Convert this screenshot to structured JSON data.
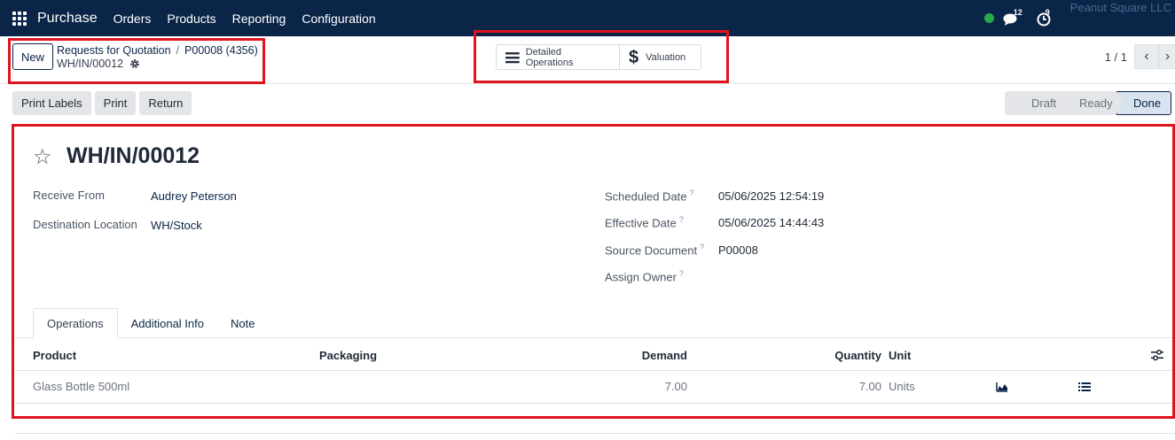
{
  "navbar": {
    "app_name": "Purchase",
    "menu": [
      "Orders",
      "Products",
      "Reporting",
      "Configuration"
    ],
    "messages_count": "12",
    "activities_count": "9",
    "company": "Peanut Square LLC"
  },
  "control_panel": {
    "new_label": "New",
    "breadcrumb": [
      "Requests for Quotation",
      "P00008 (4356)"
    ],
    "record_name": "WH/IN/00012",
    "smart_buttons": [
      "Detailed Operations",
      "Valuation"
    ],
    "pager": "1 / 1"
  },
  "actions": [
    "Print Labels",
    "Print",
    "Return"
  ],
  "stages": [
    "Draft",
    "Ready",
    "Done"
  ],
  "active_stage": "Done",
  "form": {
    "title": "WH/IN/00012",
    "left_fields": [
      {
        "label": "Receive From",
        "value": "Audrey Peterson"
      },
      {
        "label": "Destination Location",
        "value": "WH/Stock"
      }
    ],
    "right_fields": [
      {
        "label": "Scheduled Date",
        "value": "05/06/2025 12:54:19"
      },
      {
        "label": "Effective Date",
        "value": "05/06/2025 14:44:43"
      },
      {
        "label": "Source Document",
        "value": "P00008"
      },
      {
        "label": "Assign Owner",
        "value": ""
      }
    ],
    "help_mark": "?",
    "tabs": [
      "Operations",
      "Additional Info",
      "Note"
    ],
    "table": {
      "headers": [
        "Product",
        "Packaging",
        "Demand",
        "Quantity",
        "Unit"
      ],
      "rows": [
        {
          "product": "Glass Bottle 500ml",
          "packaging": "",
          "demand": "7.00",
          "quantity": "7.00",
          "unit": "Units"
        }
      ]
    }
  }
}
